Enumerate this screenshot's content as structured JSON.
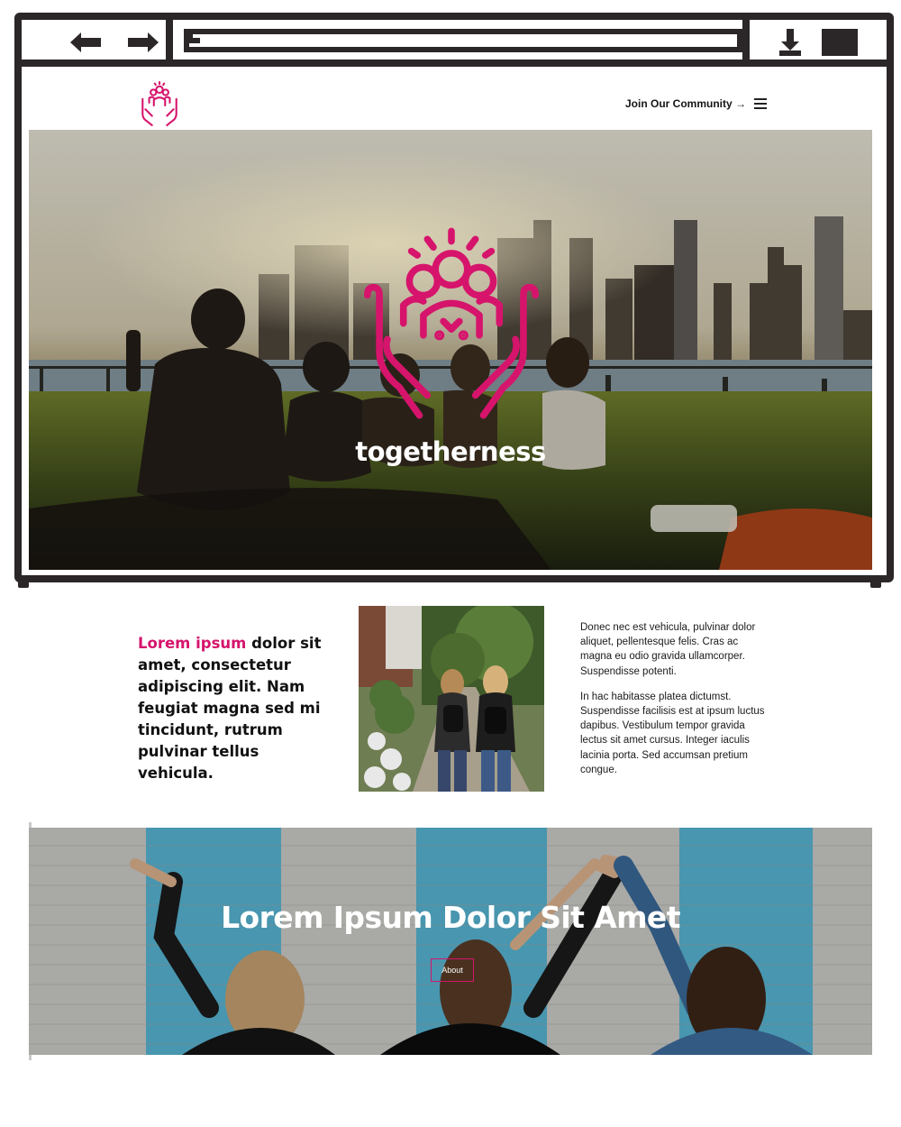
{
  "header": {
    "logo_icon": "community-hands-icon",
    "join_link": "Join Our Community →",
    "menu_icon": "hamburger-icon"
  },
  "hero": {
    "emblem_icon": "community-hands-icon",
    "title": "togetherness"
  },
  "intro": {
    "lead_accent": "Lorem ipsum",
    "lead_rest": " dolor sit amet, consectetur adipiscing elit. Nam feugiat magna sed mi tincidunt, rutrum pulvinar tellus vehicula.",
    "paragraph_1": "Donec nec est vehicula, pulvinar dolor aliquet, pellentesque felis. Cras ac magna eu odio gravida ullamcorper. Suspendisse potenti.",
    "paragraph_2": "In hac habitasse platea dictumst. Suspendisse facilisis est at ipsum luctus dapibus. Vestibulum tempor gravida lectus sit amet cursus. Integer iaculis lacinia porta. Sed accumsan pretium congue."
  },
  "banner": {
    "title": "Lorem Ipsum Dolor Sit Amet",
    "button_label": "About"
  },
  "colors": {
    "accent": "#d6146c",
    "chrome": "#2b2628",
    "text": "#111111"
  }
}
